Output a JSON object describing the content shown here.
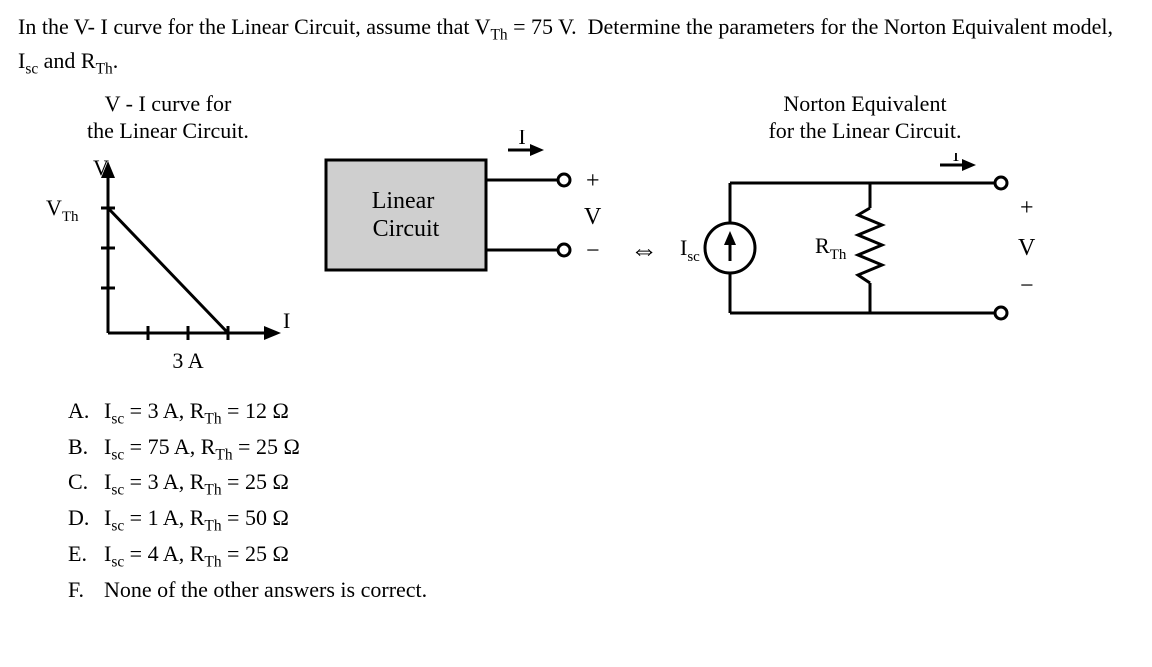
{
  "question_html": "In the V- I curve for the Linear Circuit, assume that V<sub>Th</sub> = 75 V.&nbsp; Determine the parameters for the Norton Equivalent model, I<sub>sc</sub> and R<sub>Th</sub>.",
  "graph": {
    "title_html": "V - I curve for<br>the Linear Circuit.",
    "y_axis": "V",
    "y_intercept_label": "V",
    "y_intercept_sub": "Th",
    "x_axis": "I",
    "x_intercept": "3 A"
  },
  "linear_box": {
    "label": "Linear\nCircuit",
    "I": "I",
    "plus": "+",
    "V": "V",
    "minus": "−"
  },
  "equiv_symbol": "⇔",
  "norton": {
    "title_html": "Norton Equivalent<br>for the Linear Circuit.",
    "Isc": "I",
    "Isc_sub": "sc",
    "Rth": "R",
    "Rth_sub": "Th",
    "I": "I",
    "plus": "+",
    "V": "V",
    "minus": "−"
  },
  "answers": [
    {
      "letter": "A.",
      "text_html": "I<sub>sc</sub> = 3 A, R<sub>Th</sub> = 12 Ω"
    },
    {
      "letter": "B.",
      "text_html": "I<sub>sc</sub> = 75 A, R<sub>Th</sub> = 25 Ω"
    },
    {
      "letter": "C.",
      "text_html": "I<sub>sc</sub> = 3 A, R<sub>Th</sub> = 25 Ω"
    },
    {
      "letter": "D.",
      "text_html": "I<sub>sc</sub> = 1 A, R<sub>Th</sub> = 50 Ω"
    },
    {
      "letter": "E.",
      "text_html": "I<sub>sc</sub> = 4 A, R<sub>Th</sub> = 25 Ω"
    },
    {
      "letter": "F.",
      "text_html": "None of the other answers is correct."
    }
  ],
  "chart_data": {
    "type": "line",
    "title": "V - I curve for the Linear Circuit",
    "xlabel": "I (A)",
    "ylabel": "V (V)",
    "series": [
      {
        "name": "V-I",
        "x": [
          0,
          3
        ],
        "y": [
          75,
          0
        ]
      }
    ],
    "x_intercept": 3,
    "y_intercept": 75,
    "y_intercept_label": "V_Th",
    "xlim": [
      0,
      4
    ],
    "ylim": [
      0,
      80
    ]
  }
}
